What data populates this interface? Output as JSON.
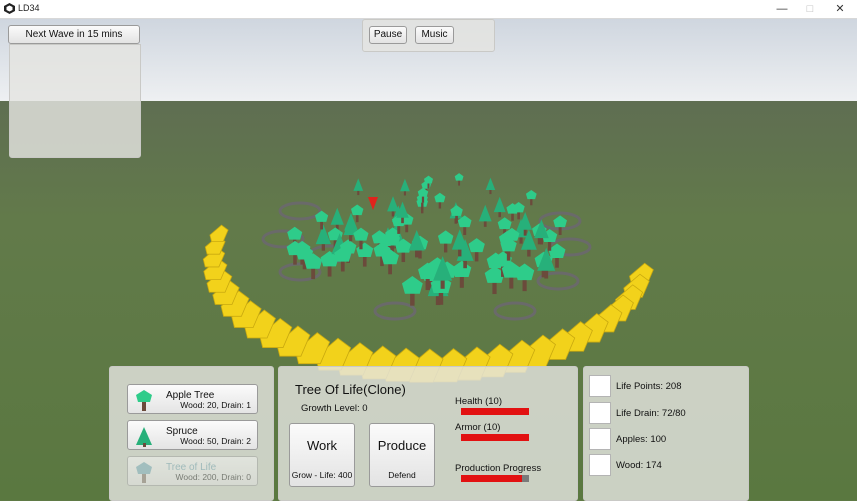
{
  "window": {
    "title": "LD34",
    "minimize": "—",
    "maximize": "□",
    "close": "✕"
  },
  "wave": {
    "label": "Next Wave in 15 mins"
  },
  "top_controls": {
    "pause": "Pause",
    "music": "Music"
  },
  "build_menu": {
    "items": [
      {
        "name": "Apple Tree",
        "cost": "Wood: 20, Drain: 1",
        "enabled": true
      },
      {
        "name": "Spruce",
        "cost": "Wood: 50, Drain: 2",
        "enabled": true
      },
      {
        "name": "Tree of Life",
        "cost": "Wood: 200, Drain: 0",
        "enabled": false
      }
    ]
  },
  "selected": {
    "title": "Tree Of Life(Clone)",
    "growth": "Growth Level: 0",
    "work_label": "Work",
    "work_sub": "Grow - Life: 400",
    "produce_label": "Produce",
    "produce_sub": "Defend",
    "health_label": "Health (10)",
    "health_fraction": 1.0,
    "armor_label": "Armor (10)",
    "armor_fraction": 1.0,
    "production_label": "Production Progress",
    "production_fraction": 0.9
  },
  "resources": {
    "items": [
      {
        "label": "Life Points: 208"
      },
      {
        "label": "Life Drain: 72/80"
      },
      {
        "label": "Apples: 100"
      },
      {
        "label": "Wood: 174"
      }
    ]
  },
  "colors": {
    "bar_fill": "#e21111",
    "bar_track": "#7a7a7a",
    "tree_green": "#2ecc8a",
    "stump": "#6b4a3b",
    "enemy_yellow": "#f2d21b",
    "highlight_red": "#e0231c"
  }
}
